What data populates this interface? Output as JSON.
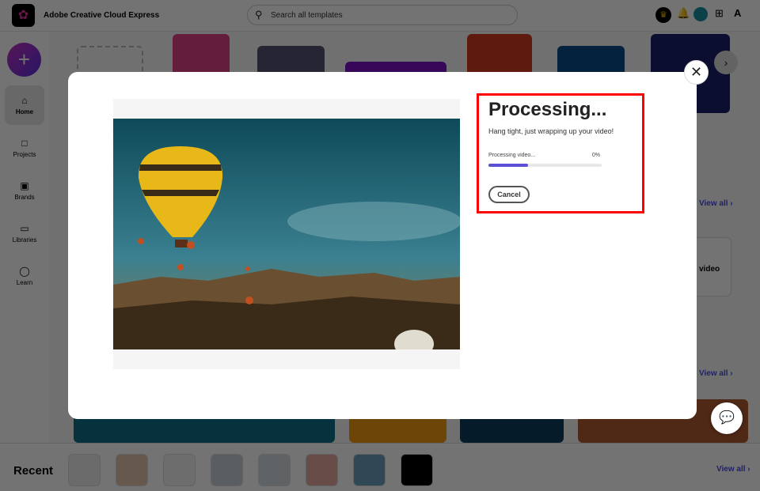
{
  "header": {
    "app_title": "Adobe Creative Cloud Express",
    "search_placeholder": "Search all templates"
  },
  "sidebar": {
    "items": [
      {
        "label": "Home"
      },
      {
        "label": "Projects"
      },
      {
        "label": "Brands"
      },
      {
        "label": "Libraries"
      },
      {
        "label": "Learn"
      }
    ]
  },
  "main": {
    "view_all": "View all",
    "video_label": "video"
  },
  "recent": {
    "label": "Recent",
    "view_all": "View all"
  },
  "modal": {
    "title": "Processing...",
    "subtitle": "Hang tight, just wrapping up your video!",
    "progress_label": "Processing video...",
    "progress_text": "0%",
    "progress_value": 0.35,
    "cancel_label": "Cancel"
  },
  "colors": {
    "accent": "#5b4fd6",
    "highlight": "#ff0000"
  }
}
